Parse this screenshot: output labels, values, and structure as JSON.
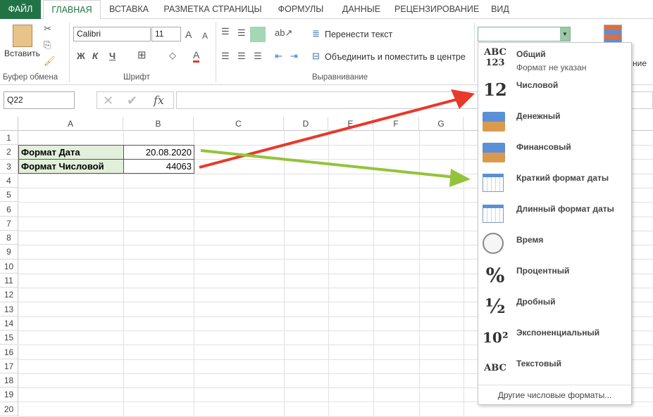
{
  "tabs": [
    "ФАЙЛ",
    "ГЛАВНАЯ",
    "ВСТАВКА",
    "РАЗМЕТКА СТРАНИЦЫ",
    "ФОРМУЛЫ",
    "ДАННЫЕ",
    "РЕЦЕНЗИРОВАНИЕ",
    "ВИД"
  ],
  "active_tab": "ГЛАВНАЯ",
  "ribbon": {
    "clipboard": {
      "paste": "Вставить",
      "label": "Буфер обмена"
    },
    "font": {
      "name": "Calibri",
      "size": "11",
      "bold": "Ж",
      "italic": "К",
      "underline": "Ч",
      "label": "Шрифт"
    },
    "alignment": {
      "wrap": "Перенести текст",
      "merge": "Объединить и поместить в центре",
      "label": "Выравнивание"
    },
    "number_format_value": "",
    "partial_right": "ние"
  },
  "formula_bar": {
    "name_box": "Q22",
    "fx": "fx",
    "value": ""
  },
  "columns": [
    "A",
    "B",
    "C",
    "D",
    "E",
    "F",
    "G"
  ],
  "rows": [
    "1",
    "2",
    "3",
    "4",
    "5",
    "6",
    "7",
    "8",
    "9",
    "10",
    "11",
    "12",
    "13",
    "14",
    "15",
    "16",
    "17",
    "18",
    "19",
    "20"
  ],
  "cells": [
    {
      "ref": "A2",
      "value": "Формат Дата"
    },
    {
      "ref": "B2",
      "value": "20.08.2020"
    },
    {
      "ref": "A3",
      "value": "Формат Числовой"
    },
    {
      "ref": "B3",
      "value": "44063"
    }
  ],
  "menu": {
    "items": [
      {
        "label": "Общий",
        "sub": "Формат не указан",
        "icon": "abc-123-icon",
        "glyph": "ABC 123"
      },
      {
        "label": "Числовой",
        "icon": "number-12-icon",
        "glyph": "12"
      },
      {
        "label": "Денежный",
        "icon": "currency-icon",
        "glyph": ""
      },
      {
        "label": "Финансовый",
        "icon": "accounting-icon",
        "glyph": ""
      },
      {
        "label": "Краткий формат даты",
        "icon": "short-date-calendar-icon",
        "glyph": ""
      },
      {
        "label": "Длинный формат даты",
        "icon": "long-date-calendar-icon",
        "glyph": ""
      },
      {
        "label": "Время",
        "icon": "clock-icon",
        "glyph": ""
      },
      {
        "label": "Процентный",
        "icon": "percent-icon",
        "glyph": "%"
      },
      {
        "label": "Дробный",
        "icon": "fraction-icon",
        "glyph": "½"
      },
      {
        "label": "Экспоненциальный",
        "icon": "scientific-icon",
        "glyph": "10²"
      },
      {
        "label": "Текстовый",
        "icon": "text-abc-icon",
        "glyph": "ABC"
      }
    ],
    "more": "Другие числовые форматы..."
  },
  "colors": {
    "accent": "#217346",
    "selected_fill": "#e2efda",
    "red_arrow": "#e8392a",
    "green_arrow": "#94c33a"
  }
}
